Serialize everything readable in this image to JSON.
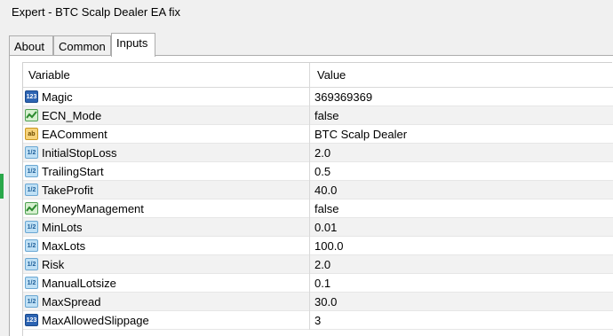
{
  "window": {
    "title": "Expert - BTC Scalp Dealer EA fix"
  },
  "tabs": [
    {
      "label": "About"
    },
    {
      "label": "Common"
    },
    {
      "label": "Inputs"
    }
  ],
  "table": {
    "columns": [
      "Variable",
      "Value"
    ],
    "rows": [
      {
        "icon": "integer-type-icon",
        "variable": "Magic",
        "value": "369369369"
      },
      {
        "icon": "boolean-type-icon",
        "variable": "ECN_Mode",
        "value": "false"
      },
      {
        "icon": "string-type-icon",
        "variable": "EAComment",
        "value": "BTC Scalp Dealer"
      },
      {
        "icon": "double-type-icon",
        "variable": "InitialStopLoss",
        "value": "2.0"
      },
      {
        "icon": "double-type-icon",
        "variable": "TrailingStart",
        "value": "0.5"
      },
      {
        "icon": "double-type-icon",
        "variable": "TakeProfit",
        "value": "40.0"
      },
      {
        "icon": "boolean-type-icon",
        "variable": "MoneyManagement",
        "value": "false"
      },
      {
        "icon": "double-type-icon",
        "variable": "MinLots",
        "value": "0.01"
      },
      {
        "icon": "double-type-icon",
        "variable": "MaxLots",
        "value": "100.0"
      },
      {
        "icon": "double-type-icon",
        "variable": "Risk",
        "value": "2.0"
      },
      {
        "icon": "double-type-icon",
        "variable": "ManualLotsize",
        "value": "0.1"
      },
      {
        "icon": "double-type-icon",
        "variable": "MaxSpread",
        "value": "30.0"
      },
      {
        "icon": "integer-type-icon",
        "variable": "MaxAllowedSlippage",
        "value": "3"
      }
    ]
  },
  "icon_glyphs": {
    "int": "123",
    "dbl": "1/2",
    "str": "ab"
  }
}
